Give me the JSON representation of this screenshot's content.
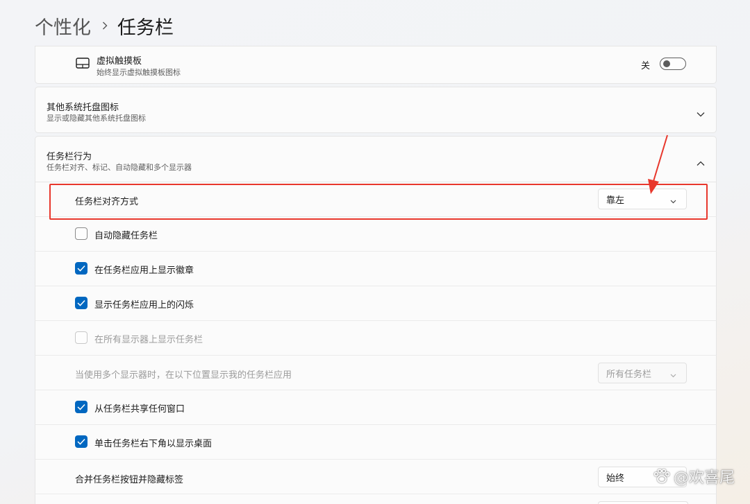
{
  "breadcrumb": {
    "parent": "个性化",
    "current": "任务栏"
  },
  "touchpad": {
    "title": "虚拟触摸板",
    "subtitle": "始终显示虚拟触摸板图标",
    "toggle_label": "关",
    "toggle_on": false
  },
  "tray": {
    "title": "其他系统托盘图标",
    "subtitle": "显示或隐藏其他系统托盘图标"
  },
  "behaviors": {
    "title": "任务栏行为",
    "subtitle": "任务栏对齐、标记、自动隐藏和多个显示器",
    "alignment": {
      "label": "任务栏对齐方式",
      "value": "靠左"
    },
    "autohide": {
      "label": "自动隐藏任务栏",
      "checked": false
    },
    "badges": {
      "label": "在任务栏应用上显示徽章",
      "checked": true
    },
    "flashing": {
      "label": "显示任务栏应用上的闪烁",
      "checked": true
    },
    "all_displays": {
      "label": "在所有显示器上显示任务栏",
      "checked": false,
      "disabled": true
    },
    "multi_display": {
      "label": "当使用多个显示器时，在以下位置显示我的任务栏应用",
      "value": "所有任务栏"
    },
    "share_window": {
      "label": "从任务栏共享任何窗口",
      "checked": true
    },
    "corner_desktop": {
      "label": "单击任务栏右下角以显示桌面",
      "checked": true
    },
    "combine": {
      "label": "合并任务栏按钮并隐藏标签",
      "value": "始终"
    }
  },
  "watermark": {
    "text": "@欢喜尾"
  },
  "colors": {
    "accent": "#0067c0",
    "highlight": "#e8372c"
  },
  "icons": [
    "chevron-right-icon",
    "touchpad-icon",
    "chevron-down-icon",
    "chevron-up-icon",
    "checkmark-icon",
    "annotation-arrow",
    "paw-icon"
  ]
}
